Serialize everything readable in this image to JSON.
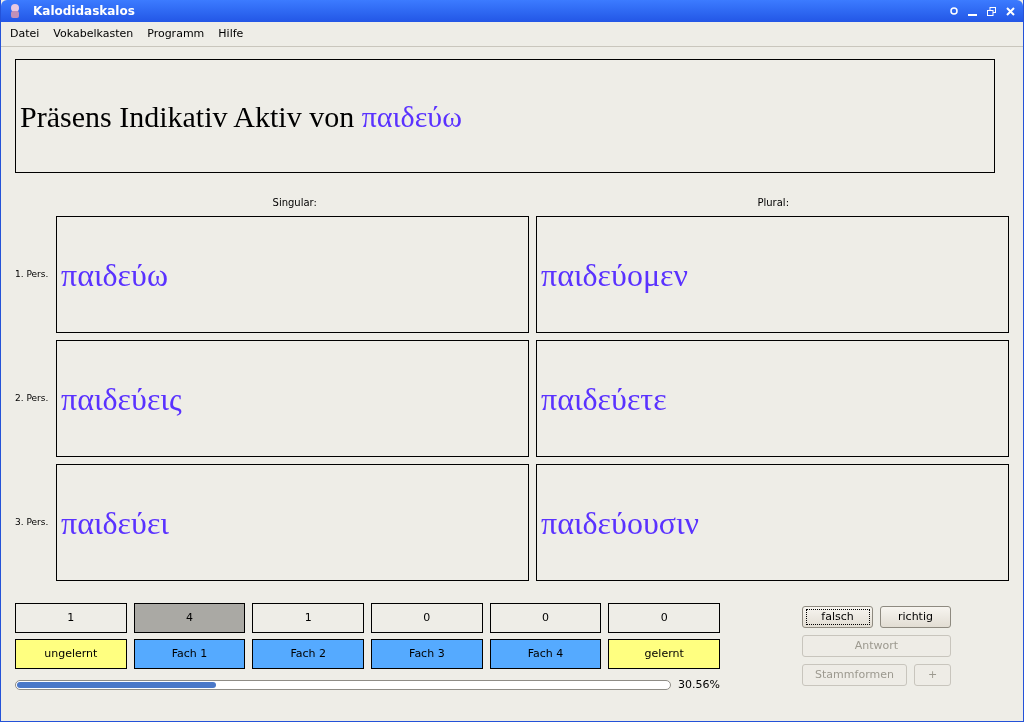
{
  "window": {
    "title": "Kalodidaskalos"
  },
  "menu": [
    "Datei",
    "Vokabelkasten",
    "Programm",
    "Hilfe"
  ],
  "prompt": {
    "text": "Präsens Indikativ Aktiv von",
    "word": "παιδεύω"
  },
  "columns": [
    "Singular:",
    "Plural:"
  ],
  "rows": [
    {
      "label": "1. Pers.",
      "cells": [
        "παιδεύω",
        "παιδεύομεν"
      ]
    },
    {
      "label": "2. Pers.",
      "cells": [
        "παιδεύεις",
        "παιδεύετε"
      ]
    },
    {
      "label": "3. Pers.",
      "cells": [
        "παιδεύει",
        "παιδεύουσιν"
      ]
    }
  ],
  "boxes": [
    {
      "count": "1",
      "selected": false,
      "label": "ungelernt",
      "color": "#ffff80"
    },
    {
      "count": "4",
      "selected": true,
      "label": "Fach 1",
      "color": "#55aaff"
    },
    {
      "count": "1",
      "selected": false,
      "label": "Fach 2",
      "color": "#55aaff"
    },
    {
      "count": "0",
      "selected": false,
      "label": "Fach 3",
      "color": "#55aaff"
    },
    {
      "count": "0",
      "selected": false,
      "label": "Fach 4",
      "color": "#55aaff"
    },
    {
      "count": "0",
      "selected": false,
      "label": "gelernt",
      "color": "#ffff80"
    }
  ],
  "progress": {
    "level": 0.3056,
    "reading": "30.56%"
  },
  "buttons": [
    {
      "label": "falsch",
      "disabled": false,
      "focused": true
    },
    {
      "label": "richtig",
      "disabled": false,
      "focused": false
    },
    {
      "label": "Antwort",
      "disabled": true,
      "focused": false
    },
    {
      "label": "Stammformen",
      "disabled": true,
      "focused": false
    },
    {
      "label": "+",
      "disabled": true,
      "focused": false
    }
  ]
}
